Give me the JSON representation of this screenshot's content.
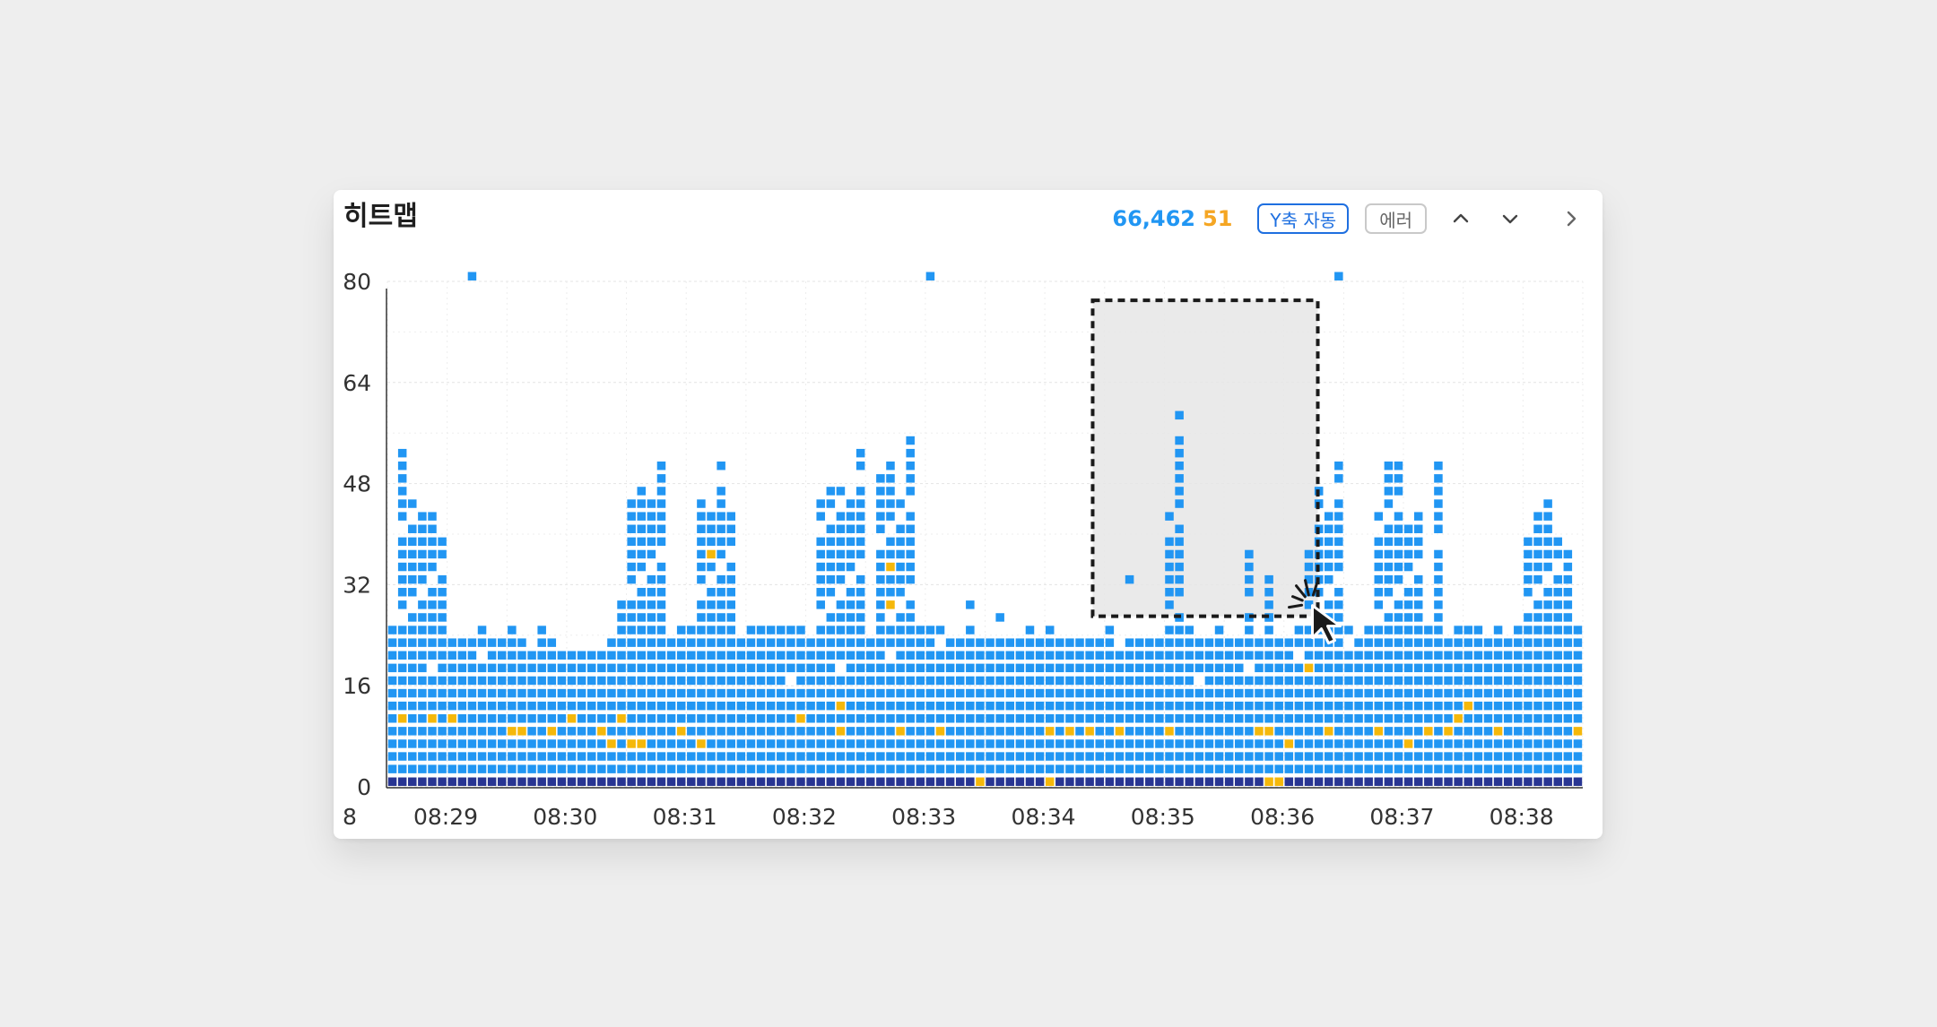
{
  "card": {
    "title": "히트맵",
    "count_total": "66,462",
    "count_error": "51",
    "y_axis_button": "Y축 자동",
    "error_button": "에러",
    "icons": [
      "chevron-up-icon",
      "chevron-down-icon",
      "chevron-right-icon",
      "cursor-pointer-icon"
    ]
  },
  "colors": {
    "normal": "#2196f3",
    "error": "#f5b80a",
    "base": "#283593",
    "count_total": "#2196f3",
    "count_error": "#f5a623",
    "selection": "#e6e6e6"
  },
  "chart_data": {
    "type": "heatmap",
    "title": "",
    "xlabel": "",
    "ylabel": "",
    "ylim": [
      0,
      80
    ],
    "y_ticks": [
      0,
      16,
      32,
      48,
      64,
      80
    ],
    "x_ticks": [
      "8",
      "08:29",
      "08:30",
      "08:31",
      "08:32",
      "08:33",
      "08:34",
      "08:35",
      "08:36",
      "08:37",
      "08:38"
    ],
    "grid": true,
    "columns": 120,
    "rows": 51,
    "stack_heights": [
      24,
      22,
      22,
      22,
      22,
      22,
      22,
      22,
      22,
      24,
      22,
      22,
      24,
      22,
      20,
      24,
      22,
      20,
      20,
      20,
      20,
      20,
      22,
      24,
      24,
      24,
      24,
      24,
      22,
      24,
      24,
      24,
      24,
      24,
      22,
      22,
      24,
      24,
      24,
      24,
      24,
      24,
      22,
      24,
      22,
      24,
      22,
      22,
      22,
      24,
      22,
      22,
      22,
      24,
      24,
      24,
      22,
      22,
      24,
      22,
      22,
      22,
      22,
      22,
      24,
      22,
      24,
      22,
      22,
      22,
      22,
      22,
      24,
      20,
      22,
      22,
      22,
      22,
      22,
      22,
      24,
      22,
      22,
      24,
      22,
      22,
      22,
      22,
      24,
      22,
      22,
      24,
      22,
      24,
      22,
      22,
      24,
      22,
      24,
      22,
      24,
      22,
      24,
      24,
      24,
      24,
      22,
      24,
      24,
      24,
      22,
      24,
      22,
      24,
      22,
      22,
      22,
      22,
      24,
      24
    ],
    "cluster_columns": [
      {
        "col": 1,
        "top": 52
      },
      {
        "col": 2,
        "top": 44
      },
      {
        "col": 3,
        "top": 42
      },
      {
        "col": 4,
        "top": 42
      },
      {
        "col": 5,
        "top": 38
      },
      {
        "col": 23,
        "top": 28
      },
      {
        "col": 24,
        "top": 44
      },
      {
        "col": 25,
        "top": 46
      },
      {
        "col": 26,
        "top": 44
      },
      {
        "col": 27,
        "top": 50
      },
      {
        "col": 31,
        "top": 44
      },
      {
        "col": 32,
        "top": 42
      },
      {
        "col": 33,
        "top": 50
      },
      {
        "col": 34,
        "top": 42
      },
      {
        "col": 43,
        "top": 44
      },
      {
        "col": 44,
        "top": 46
      },
      {
        "col": 45,
        "top": 46
      },
      {
        "col": 46,
        "top": 44
      },
      {
        "col": 47,
        "top": 52
      },
      {
        "col": 49,
        "top": 48
      },
      {
        "col": 50,
        "top": 50
      },
      {
        "col": 51,
        "top": 44
      },
      {
        "col": 52,
        "top": 54
      },
      {
        "col": 78,
        "top": 42
      },
      {
        "col": 79,
        "top": 58
      },
      {
        "col": 86,
        "top": 36
      },
      {
        "col": 88,
        "top": 32
      },
      {
        "col": 92,
        "top": 36
      },
      {
        "col": 93,
        "top": 46
      },
      {
        "col": 94,
        "top": 42
      },
      {
        "col": 95,
        "top": 50
      },
      {
        "col": 99,
        "top": 42
      },
      {
        "col": 100,
        "top": 50
      },
      {
        "col": 101,
        "top": 50
      },
      {
        "col": 102,
        "top": 40
      },
      {
        "col": 103,
        "top": 42
      },
      {
        "col": 105,
        "top": 50
      },
      {
        "col": 114,
        "top": 38
      },
      {
        "col": 115,
        "top": 42
      },
      {
        "col": 116,
        "top": 44
      },
      {
        "col": 117,
        "top": 38
      },
      {
        "col": 118,
        "top": 36
      }
    ],
    "outliers": [
      {
        "col": 8,
        "y": 80
      },
      {
        "col": 54,
        "y": 80
      },
      {
        "col": 95,
        "y": 80
      },
      {
        "col": 74,
        "y": 32
      },
      {
        "col": 58,
        "y": 28
      },
      {
        "col": 61,
        "y": 26
      }
    ],
    "error_cells": [
      {
        "col": 1,
        "y": 10
      },
      {
        "col": 4,
        "y": 10
      },
      {
        "col": 6,
        "y": 10
      },
      {
        "col": 12,
        "y": 8
      },
      {
        "col": 13,
        "y": 8
      },
      {
        "col": 16,
        "y": 8
      },
      {
        "col": 18,
        "y": 10
      },
      {
        "col": 21,
        "y": 8
      },
      {
        "col": 22,
        "y": 6
      },
      {
        "col": 23,
        "y": 10
      },
      {
        "col": 24,
        "y": 6
      },
      {
        "col": 25,
        "y": 6
      },
      {
        "col": 29,
        "y": 8
      },
      {
        "col": 31,
        "y": 6
      },
      {
        "col": 32,
        "y": 36
      },
      {
        "col": 41,
        "y": 10
      },
      {
        "col": 45,
        "y": 12
      },
      {
        "col": 45,
        "y": 8
      },
      {
        "col": 50,
        "y": 34
      },
      {
        "col": 50,
        "y": 28
      },
      {
        "col": 51,
        "y": 8
      },
      {
        "col": 55,
        "y": 8
      },
      {
        "col": 59,
        "y": 0
      },
      {
        "col": 66,
        "y": 8
      },
      {
        "col": 66,
        "y": 0
      },
      {
        "col": 68,
        "y": 8
      },
      {
        "col": 70,
        "y": 8
      },
      {
        "col": 73,
        "y": 8
      },
      {
        "col": 78,
        "y": 8
      },
      {
        "col": 85,
        "y": 36
      },
      {
        "col": 87,
        "y": 8
      },
      {
        "col": 88,
        "y": 8
      },
      {
        "col": 88,
        "y": 0
      },
      {
        "col": 89,
        "y": 0
      },
      {
        "col": 90,
        "y": 6
      },
      {
        "col": 92,
        "y": 18
      },
      {
        "col": 94,
        "y": 8
      },
      {
        "col": 99,
        "y": 8
      },
      {
        "col": 102,
        "y": 6
      },
      {
        "col": 104,
        "y": 8
      },
      {
        "col": 106,
        "y": 8
      },
      {
        "col": 107,
        "y": 10
      },
      {
        "col": 108,
        "y": 12
      },
      {
        "col": 111,
        "y": 8
      },
      {
        "col": 119,
        "y": 8
      }
    ],
    "selection": {
      "x_start": "08:34:23",
      "x_end": "08:36:16",
      "y_min": 27,
      "y_max": 77
    }
  }
}
